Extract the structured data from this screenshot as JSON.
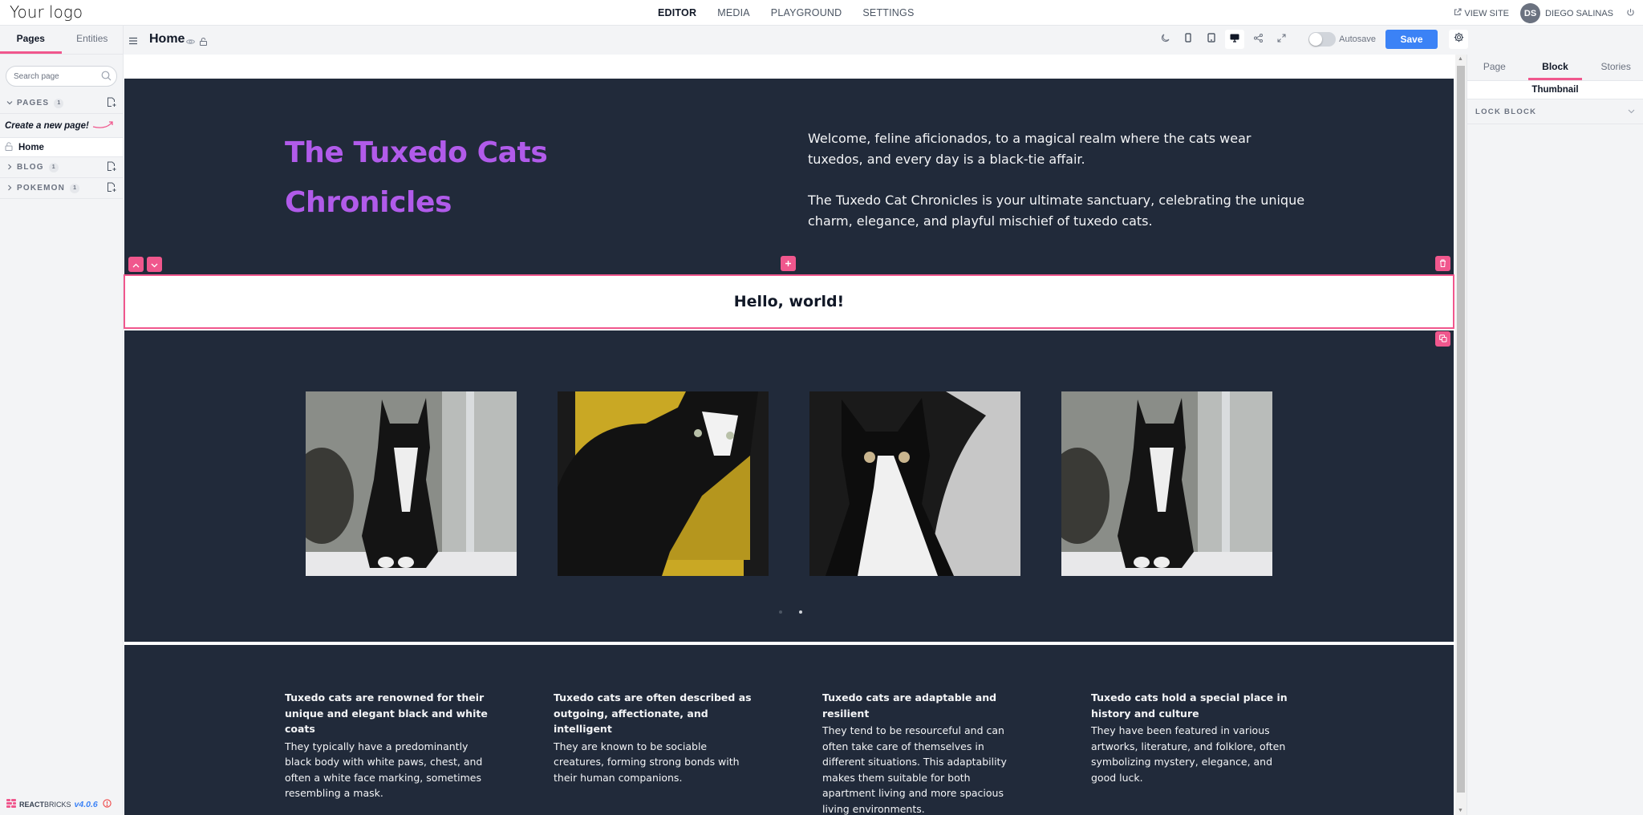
{
  "app": {
    "logo": "Your logo",
    "nav": [
      {
        "label": "EDITOR",
        "active": true
      },
      {
        "label": "MEDIA",
        "active": false
      },
      {
        "label": "PLAYGROUND",
        "active": false
      },
      {
        "label": "SETTINGS",
        "active": false
      }
    ],
    "view_site": "VIEW SITE",
    "user": {
      "initials": "DS",
      "name": "DIEGO SALINAS"
    }
  },
  "sidebar": {
    "tabs": [
      "Pages",
      "Entities"
    ],
    "active_tab": "Pages",
    "search_placeholder": "Search page",
    "sections": [
      {
        "label": "PAGES",
        "count": "1",
        "expanded": true
      },
      {
        "label": "BLOG",
        "count": "1",
        "expanded": false
      },
      {
        "label": "POKEMON",
        "count": "1",
        "expanded": false
      }
    ],
    "hint": "Create a new page!",
    "pages": [
      {
        "label": "Home",
        "locked": true
      }
    ],
    "footer": {
      "brand_a": "REACT",
      "brand_b": "BRICKS",
      "version": "v4.0.6"
    }
  },
  "editor": {
    "page_title": "Home",
    "autosave_label": "Autosave",
    "autosave_on": false,
    "save_label": "Save",
    "device": "desktop"
  },
  "content": {
    "hero": {
      "title": "The Tuxedo Cats Chronicles",
      "paragraphs": [
        "Welcome, feline aficionados, to a magical realm where the cats wear tuxedos, and every day is a black-tie affair.",
        "The Tuxedo Cat Chronicles is your ultimate sanctuary, celebrating the unique charm, elegance, and playful mischief of tuxedo cats."
      ]
    },
    "hello_block": "Hello, world!",
    "gallery": {
      "images": [
        "tuxedo-cat-sitting",
        "tuxedo-cat-yellow-chair",
        "tuxedo-cat-closeup",
        "tuxedo-cat-sitting"
      ],
      "pages": 2,
      "current_page": 2
    },
    "features": [
      {
        "title": "Tuxedo cats are renowned for their unique and elegant black and white coats",
        "text": "They typically have a predominantly black body with white paws, chest, and often a white face marking, sometimes resembling a mask."
      },
      {
        "title": "Tuxedo cats are often described as outgoing, affectionate, and intelligent",
        "text": "They are known to be sociable creatures, forming strong bonds with their human companions."
      },
      {
        "title": "Tuxedo cats are adaptable and resilient",
        "text": "They tend to be resourceful and can often take care of themselves in different situations. This adaptability makes them suitable for both apartment living and more spacious living environments."
      },
      {
        "title": "Tuxedo cats hold a special place in history and culture",
        "text": "They have been featured in various artworks, literature, and folklore, often symbolizing mystery, elegance, and good luck."
      }
    ]
  },
  "right_panel": {
    "tabs": [
      "Page",
      "Block",
      "Stories"
    ],
    "active_tab": "Block",
    "thumbnail_label": "Thumbnail",
    "lock_block_label": "LOCK BLOCK"
  },
  "colors": {
    "accent": "#f0578d",
    "primary": "#3b82f6",
    "hero_title": "#b15bea",
    "dark_bg": "#212a3a"
  }
}
